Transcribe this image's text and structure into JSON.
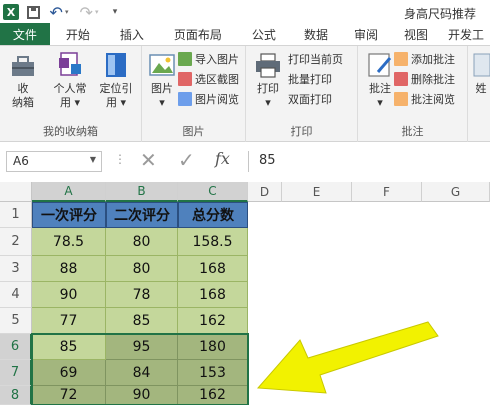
{
  "app": {
    "logo_letter": "X"
  },
  "title_bar": {
    "doc_title": "身高尺码推荐"
  },
  "tabs": [
    {
      "label": "文件"
    },
    {
      "label": "开始"
    },
    {
      "label": "插入"
    },
    {
      "label": "页面布局"
    },
    {
      "label": "公式"
    },
    {
      "label": "数据"
    },
    {
      "label": "审阅"
    },
    {
      "label": "视图"
    },
    {
      "label": "开发工"
    }
  ],
  "ribbon": {
    "group1": {
      "label": "我的收纳箱",
      "btn_collect": "收\n纳箱",
      "btn_personal": "个人常\n用 ▾",
      "btn_locate": "定位引\n用 ▾"
    },
    "group2": {
      "label": "图片",
      "btn_picture": "图片\n▾",
      "import_picture": "导入图片",
      "select_screenshot": "选区截图",
      "picture_view": "图片阅览"
    },
    "group3": {
      "label": "打印",
      "btn_print": "打印\n▾",
      "print_current": "打印当前页",
      "batch_print": "批量打印",
      "duplex_print": "双面打印"
    },
    "group4": {
      "label": "批注",
      "btn_comment": "批注\n▾",
      "add_comment": "添加批注",
      "delete_comment": "删除批注",
      "view_comment": "批注阅览"
    },
    "group5": {
      "btn_partial": "姓"
    }
  },
  "formula_bar": {
    "name_box": "A6",
    "cancel_symbol": "✕",
    "enter_symbol": "✓",
    "fx_symbol": "fx",
    "value": "85"
  },
  "sheet": {
    "columns": [
      "A",
      "B",
      "C",
      "D",
      "E",
      "F",
      "G"
    ],
    "rows": [
      "1",
      "2",
      "3",
      "4",
      "5",
      "6",
      "7",
      "8"
    ],
    "header": [
      "一次评分",
      "二次评分",
      "总分数"
    ],
    "data": [
      [
        "78.5",
        "80",
        "158.5"
      ],
      [
        "88",
        "80",
        "168"
      ],
      [
        "90",
        "78",
        "168"
      ],
      [
        "77",
        "85",
        "162"
      ],
      [
        "85",
        "95",
        "180"
      ],
      [
        "69",
        "84",
        "153"
      ],
      [
        "72",
        "90",
        "162"
      ]
    ]
  },
  "colors": {
    "excel_green": "#217346",
    "header_blue": "#4f81bd",
    "light_green": "#c4d79b",
    "dark_green": "#a3b67e",
    "arrow_yellow": "#f2f200"
  }
}
